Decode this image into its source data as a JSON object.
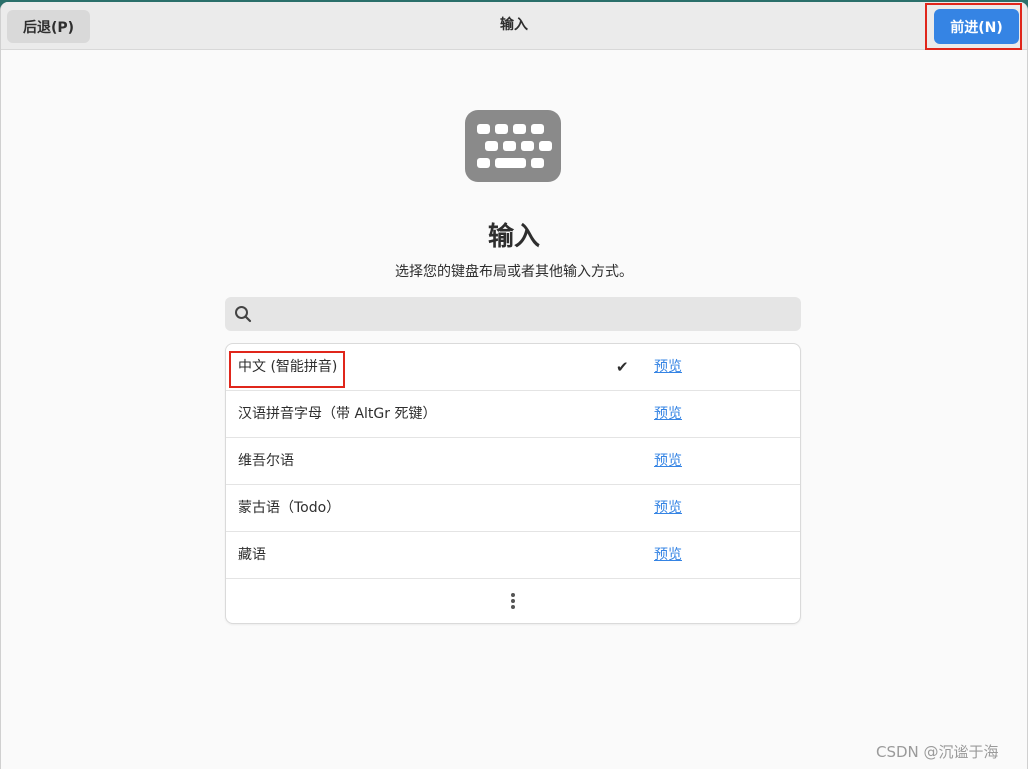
{
  "header": {
    "back_label": "后退(P)",
    "title": "输入",
    "next_label": "前进(N)"
  },
  "page": {
    "title": "输入",
    "subtitle": "选择您的键盘布局或者其他输入方式。"
  },
  "search": {
    "value": "",
    "placeholder": ""
  },
  "inputs": [
    {
      "label": "中文 (智能拼音)",
      "selected": true,
      "preview_label": "预览"
    },
    {
      "label": "汉语拼音字母（带 AltGr 死键）",
      "selected": false,
      "preview_label": "预览"
    },
    {
      "label": "维吾尔语",
      "selected": false,
      "preview_label": "预览"
    },
    {
      "label": "蒙古语（Todo）",
      "selected": false,
      "preview_label": "预览"
    },
    {
      "label": "藏语",
      "selected": false,
      "preview_label": "预览"
    }
  ],
  "check_mark": "✔",
  "watermark": "CSDN @沉谧于海",
  "colors": {
    "accent": "#3584e4",
    "highlight": "#e0261b"
  }
}
